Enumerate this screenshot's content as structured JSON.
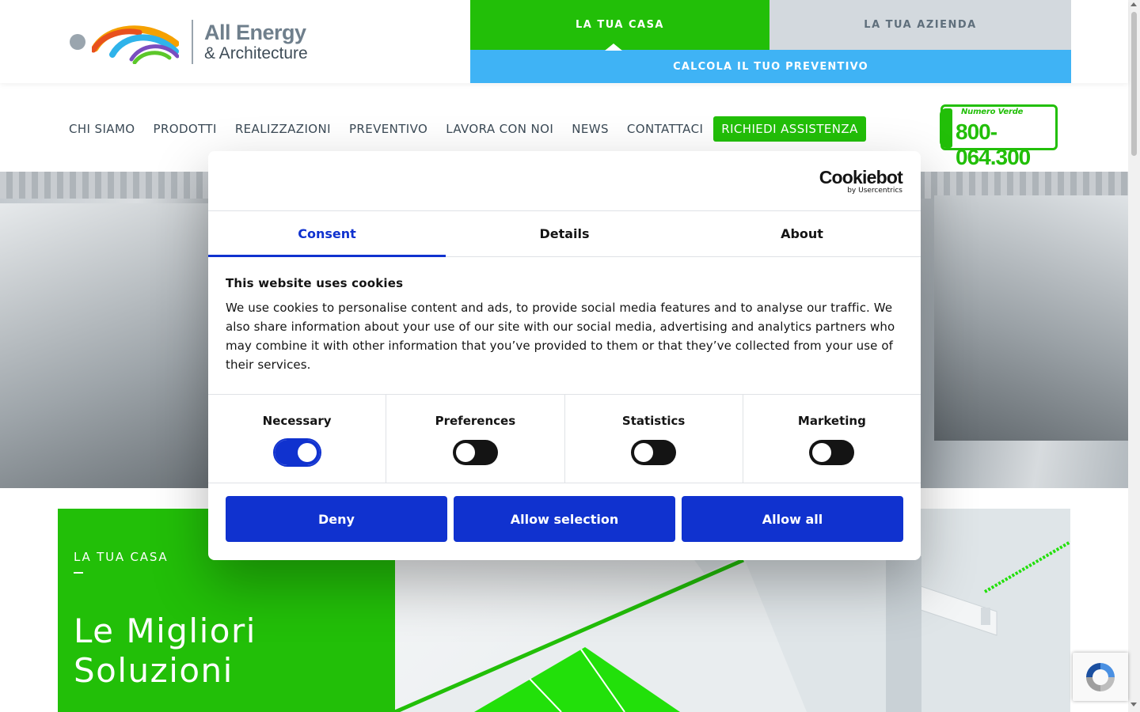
{
  "header": {
    "logo_line1": "All Energy",
    "logo_line2": "& Architecture",
    "tab_casa": "LA TUA CASA",
    "tab_azienda": "LA TUA AZIENDA",
    "preventivo_bar": "CALCOLA IL TUO PREVENTIVO"
  },
  "nav": {
    "items": [
      "CHI SIAMO",
      "PRODOTTI",
      "REALIZZAZIONI",
      "PREVENTIVO",
      "LAVORA CON NOI",
      "NEWS",
      "CONTATTACI"
    ],
    "assist": "RICHIEDI ASSISTENZA",
    "numero_verde_label": "Numero Verde",
    "numero_verde_number": "800-064.300"
  },
  "section": {
    "label": "LA TUA CASA",
    "title_line1": "Le Migliori",
    "title_line2": "Soluzioni"
  },
  "cookie": {
    "brand": "Cookiebot",
    "brand_sub": "by Usercentrics",
    "tabs": [
      "Consent",
      "Details",
      "About"
    ],
    "heading": "This website uses cookies",
    "text": "We use cookies to personalise content and ads, to provide social media features and to analyse our traffic. We also share information about your use of our site with our social media, advertising and analytics partners who may combine it with other information that you’ve provided to them or that they’ve collected from your use of their services.",
    "toggles": [
      {
        "label": "Necessary",
        "on": true
      },
      {
        "label": "Preferences",
        "on": false
      },
      {
        "label": "Statistics",
        "on": false
      },
      {
        "label": "Marketing",
        "on": false
      }
    ],
    "buttons": {
      "deny": "Deny",
      "allow_selection": "Allow selection",
      "allow_all": "Allow all"
    }
  },
  "colors": {
    "brand_green": "#22bf08",
    "brand_blue": "#3fb3f5",
    "cookiebot_blue": "#1032cf",
    "tab_grey": "#d3d9de"
  }
}
